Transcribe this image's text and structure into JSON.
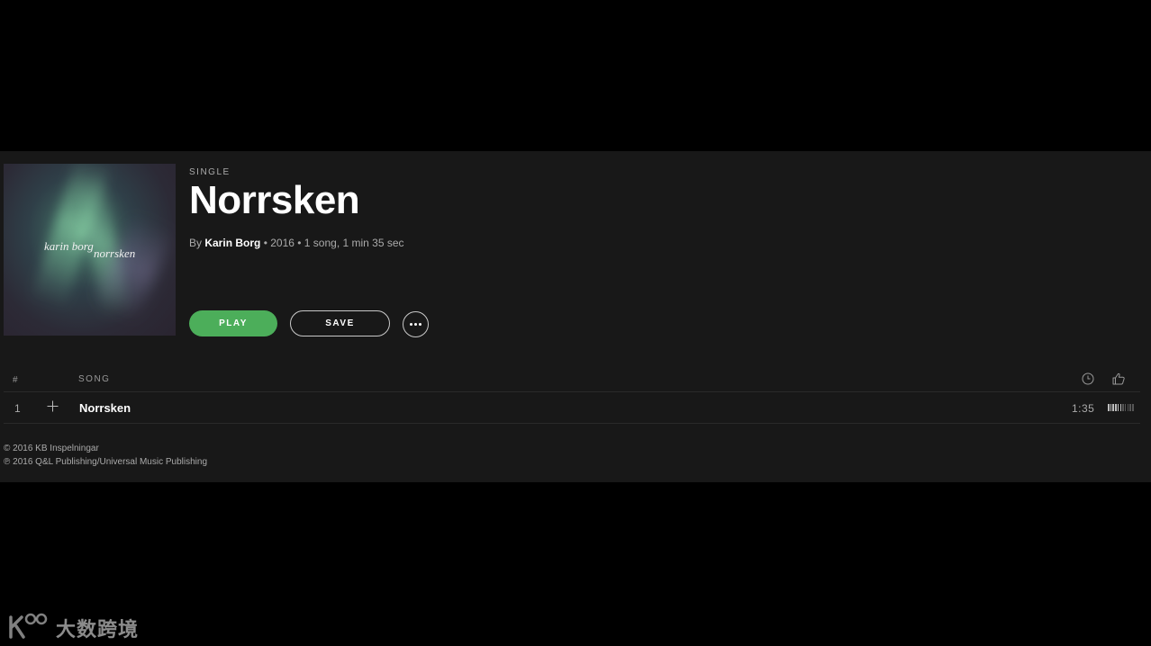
{
  "album": {
    "type_label": "SINGLE",
    "title": "Norrsken",
    "by_prefix": "By ",
    "artist": "Karin Borg",
    "meta_suffix": " • 2016 • 1 song, 1 min 35 sec",
    "cover_artist_text": "karin borg",
    "cover_title_text": "norrsken"
  },
  "actions": {
    "play_label": "PLAY",
    "save_label": "SAVE",
    "more_icon": "more-dots-icon"
  },
  "tracklist": {
    "columns": {
      "number": "#",
      "song": "SONG",
      "duration_icon": "clock-icon",
      "like_icon": "thumbs-up-icon"
    },
    "tracks": [
      {
        "number": "1",
        "name": "Norrsken",
        "duration": "1:35",
        "popularity": 0.5
      }
    ]
  },
  "copyright": {
    "line1": "© 2016 KB Inspelningar",
    "line2": "℗ 2016 Q&L Publishing/Universal Music Publishing"
  },
  "watermark": {
    "text": "大数跨境"
  },
  "colors": {
    "accent_green": "#4cae5a",
    "panel_bg": "#181818",
    "page_bg": "#000000"
  }
}
